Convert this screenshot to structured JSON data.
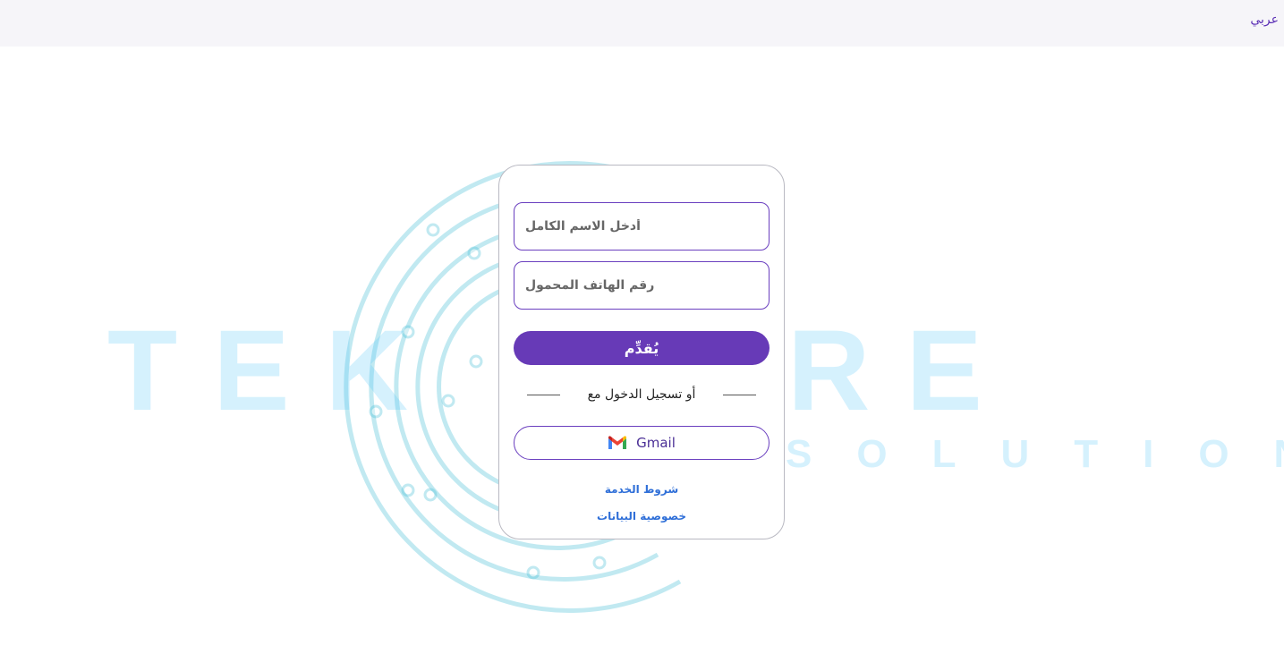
{
  "header": {
    "language_link": "عربي"
  },
  "background": {
    "logo_text_main": "TEK",
    "logo_text_main_2": "RE",
    "logo_text_sub": "SOLUTIONS",
    "logo_color": "#5ac8fa"
  },
  "form": {
    "name_placeholder": "أدخل الاسم الكامل",
    "phone_placeholder": "رقم الهاتف المحمول",
    "submit_label": "يُقدِّم",
    "divider_text": "أو تسجيل الدخول مع",
    "gmail_label": "Gmail",
    "gmail_icon": "gmail-icon"
  },
  "footer_links": {
    "terms": "شروط الخدمة",
    "privacy": "خصوصية البيانات"
  },
  "colors": {
    "accent": "#673ab7",
    "link": "#2f6fd8"
  }
}
